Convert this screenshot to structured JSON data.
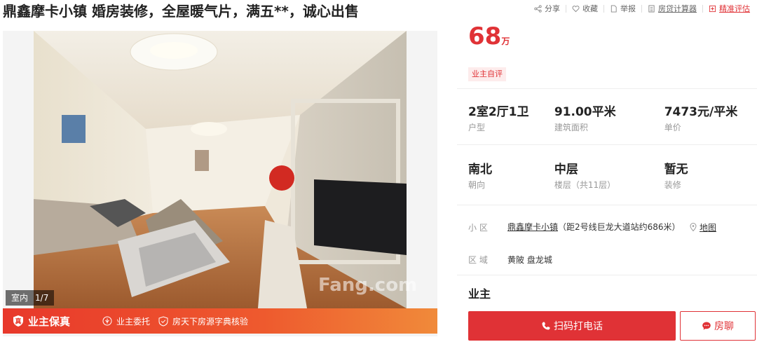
{
  "listing": {
    "title": "鼎鑫摩卡小镇 婚房装修，全屋暖气片，满五**，诚心出售"
  },
  "actions": {
    "share": "分享",
    "favorite": "收藏",
    "report": "举报",
    "calculator": "房贷计算器",
    "evaluate": "精准评估"
  },
  "gallery": {
    "room_label": "室内",
    "counter": "1/7",
    "watermark": "Fang.com"
  },
  "guarantee": {
    "main": "业主保真",
    "item1": "业主委托",
    "item2": "房天下房源字典核验"
  },
  "price": {
    "value": "68",
    "unit": "万",
    "badge": "业主自评"
  },
  "facts_row1": [
    {
      "value": "2室2厅1卫",
      "label": "户型"
    },
    {
      "value": "91.00平米",
      "label": "建筑面积"
    },
    {
      "value": "7473元/平米",
      "label": "单价"
    }
  ],
  "facts_row2": [
    {
      "value": "南北",
      "label": "朝向"
    },
    {
      "value": "中层",
      "label": "楼层（共11层）"
    },
    {
      "value": "暂无",
      "label": "装修"
    }
  ],
  "community": {
    "key": "小 区",
    "name": "鼎鑫摩卡小镇",
    "distance": "（距2号线巨龙大道站约686米）",
    "map": "地图"
  },
  "area": {
    "key": "区 域",
    "value": "黄陂 盘龙城"
  },
  "owner": {
    "label": "业主"
  },
  "buttons": {
    "call": "扫码打电话",
    "chat": "房聊"
  },
  "colors": {
    "accent": "#e03236",
    "banner_start": "#e8382b",
    "banner_end": "#f08a3a"
  }
}
